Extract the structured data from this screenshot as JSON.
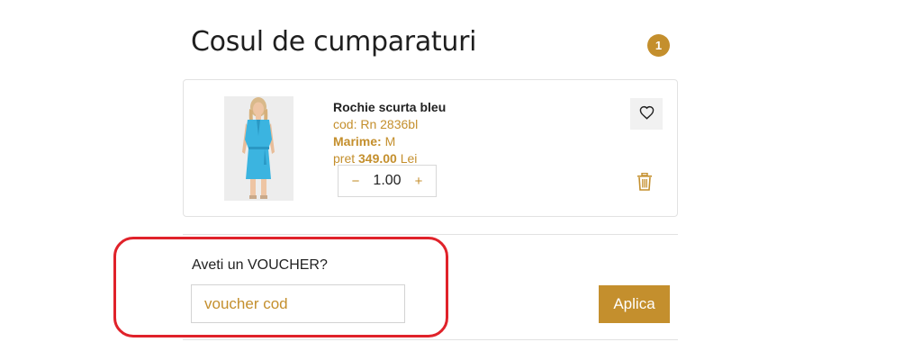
{
  "header": {
    "title": "Cosul de cumparaturi",
    "item_count": "1"
  },
  "cart_item": {
    "name": "Rochie scurta bleu",
    "code_label": "cod:",
    "code_value": "Rn 2836bl",
    "size_label": "Marime:",
    "size_value": "M",
    "price_label": "pret",
    "price_value": "349.00",
    "price_currency": "Lei",
    "quantity": "1.00",
    "decrement_label": "−",
    "increment_label": "+",
    "wishlist_icon": "heart-outline-icon",
    "delete_icon": "trash-icon"
  },
  "voucher": {
    "label": "Aveti un VOUCHER?",
    "placeholder": "voucher cod",
    "apply_label": "Aplica"
  },
  "colors": {
    "accent": "#c48f2d",
    "highlight": "#e0222a",
    "product_dress": "#3bb4e0"
  }
}
